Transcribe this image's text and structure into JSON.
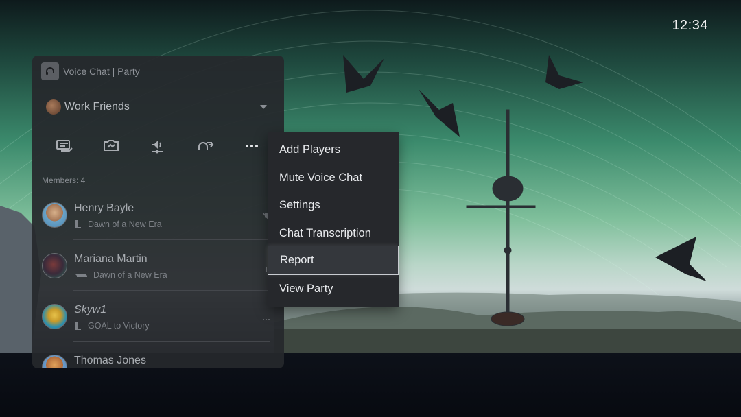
{
  "clock": {
    "time": "12:34"
  },
  "panel": {
    "title": "Voice Chat | Party",
    "app_icon": "headset-icon",
    "group": {
      "name": "Work Friends"
    },
    "toolbar": [
      {
        "name": "share-screen-icon"
      },
      {
        "name": "game-share-icon"
      },
      {
        "name": "audio-settings-icon"
      },
      {
        "name": "leave-party-icon"
      },
      {
        "name": "more-options-icon"
      }
    ],
    "members_label": "Members: 4",
    "members": [
      {
        "name": "Henry Bayle",
        "game": "Dawn of a New Era",
        "device": "ps5-console-icon",
        "italic": false
      },
      {
        "name": "Mariana Martin",
        "game": "Dawn of a New Era",
        "device": "ps4-console-icon",
        "italic": false
      },
      {
        "name": "Skyw1",
        "game": "GOAL to Victory",
        "device": "ps5-console-icon",
        "italic": true
      },
      {
        "name": "Thomas Jones",
        "game": "",
        "device": "",
        "italic": false
      }
    ]
  },
  "menu": {
    "items": [
      {
        "label": "Add Players"
      },
      {
        "label": "Mute Voice Chat"
      },
      {
        "label": "Settings"
      },
      {
        "label": "Chat Transcription"
      },
      {
        "label": "Report"
      },
      {
        "label": "View Party"
      }
    ],
    "selected_index": 4
  },
  "colors": {
    "panel_bg": "#26282c",
    "menu_text": "#e9ebee",
    "sky_green": "#3b8a6c"
  }
}
